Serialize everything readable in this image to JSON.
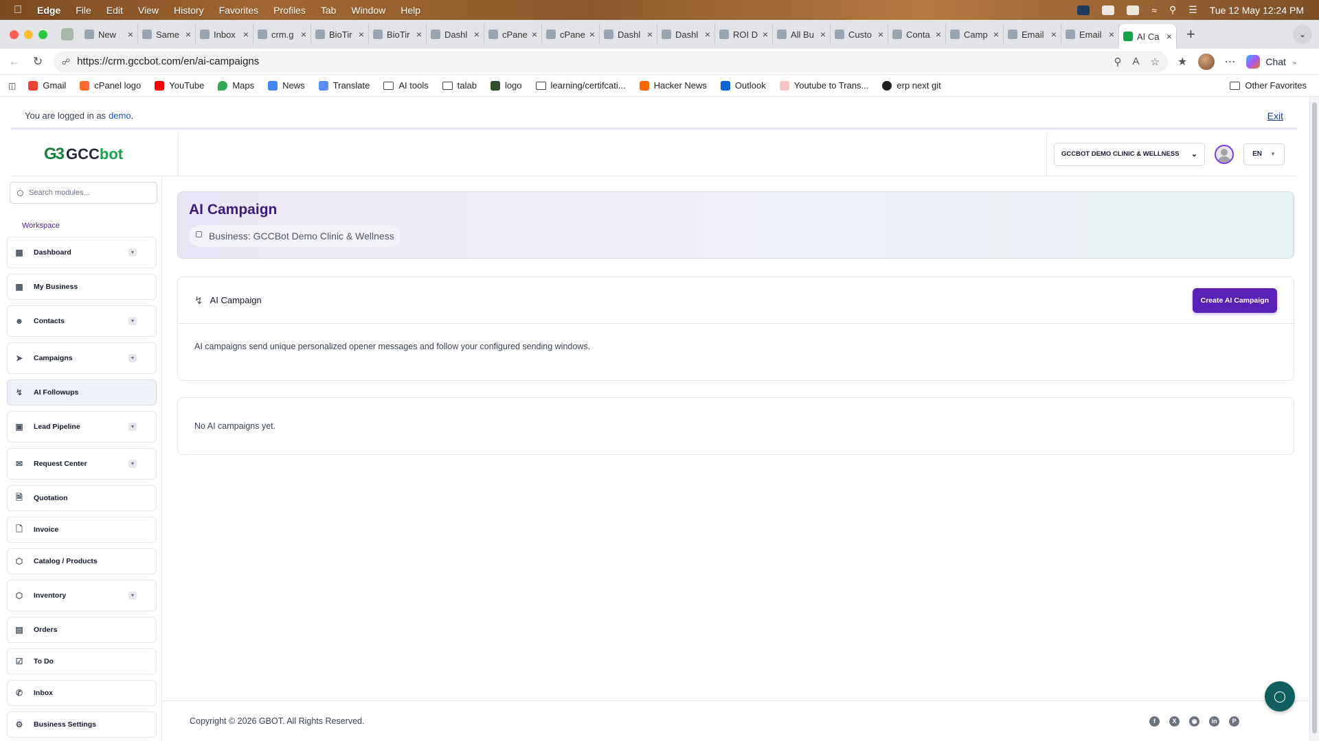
{
  "menubar": {
    "app": "Edge",
    "items": [
      "File",
      "Edit",
      "View",
      "History",
      "Favorites",
      "Profiles",
      "Tab",
      "Window",
      "Help"
    ],
    "clock": "Tue 12 May  12:24 PM"
  },
  "tabs": [
    {
      "title": "New"
    },
    {
      "title": "Same"
    },
    {
      "title": "Inbox"
    },
    {
      "title": "crm.g"
    },
    {
      "title": "BioTir"
    },
    {
      "title": "BioTir"
    },
    {
      "title": "Dashl"
    },
    {
      "title": "cPane"
    },
    {
      "title": "cPane"
    },
    {
      "title": "Dashl"
    },
    {
      "title": "Dashl"
    },
    {
      "title": "ROI D"
    },
    {
      "title": "All Bu"
    },
    {
      "title": "Custo"
    },
    {
      "title": "Conta"
    },
    {
      "title": "Camp"
    },
    {
      "title": "Email"
    },
    {
      "title": "Email"
    },
    {
      "title": "AI Ca"
    }
  ],
  "browser": {
    "url": "https://crm.gccbot.com/en/ai-campaigns",
    "chat_label": "Chat"
  },
  "bookmarks": {
    "items": [
      "Gmail",
      "cPanel logo",
      "YouTube",
      "Maps",
      "News",
      "Translate",
      "AI tools",
      "talab",
      "logo",
      "learning/certifcati...",
      "Hacker News",
      "Outlook",
      "Youtube to Trans...",
      "erp next git"
    ],
    "other": "Other Favorites"
  },
  "login": {
    "prefix": "You are logged in as",
    "user": "demo.",
    "exit": "Exit"
  },
  "header": {
    "logo_mark": "G3",
    "logo_gcc": "GCC",
    "logo_bot": "bot",
    "business_select": "GCCBOT DEMO CLINIC & WELLNESS",
    "language": "EN"
  },
  "sidebar": {
    "search_placeholder": "Search modules...",
    "section": "Workspace",
    "items": [
      {
        "label": "Dashboard",
        "icon": "grid-icon",
        "dropdown": true
      },
      {
        "label": "My Business",
        "icon": "building-icon",
        "dropdown": false
      },
      {
        "label": "Contacts",
        "icon": "users-icon",
        "dropdown": true
      },
      {
        "label": "Campaigns",
        "icon": "send-icon",
        "dropdown": true
      },
      {
        "label": "AI Followups",
        "icon": "bolt-icon",
        "dropdown": false,
        "active": true
      },
      {
        "label": "Lead Pipeline",
        "icon": "briefcase-icon",
        "dropdown": true
      },
      {
        "label": "Request Center",
        "icon": "inbox-icon",
        "dropdown": true
      },
      {
        "label": "Quotation",
        "icon": "file-dollar-icon",
        "dropdown": false
      },
      {
        "label": "Invoice",
        "icon": "file-text-icon",
        "dropdown": false
      },
      {
        "label": "Catalog / Products",
        "icon": "box-icon",
        "dropdown": false
      },
      {
        "label": "Inventory",
        "icon": "package-icon",
        "dropdown": true
      },
      {
        "label": "Orders",
        "icon": "bag-icon",
        "dropdown": false
      },
      {
        "label": "To Do",
        "icon": "checkbox-icon",
        "dropdown": false
      },
      {
        "label": "Inbox",
        "icon": "whatsapp-icon",
        "dropdown": false
      },
      {
        "label": "Business Settings",
        "icon": "gear-icon",
        "dropdown": false
      }
    ]
  },
  "main": {
    "title": "AI Campaign",
    "business_pill": "Business: GCCBot Demo Clinic & Wellness",
    "card_title": "AI Campaign",
    "create_button": "Create AI Campaign",
    "description": "AI campaigns send unique personalized opener messages and follow your configured sending windows.",
    "empty": "No AI campaigns yet."
  },
  "footer": {
    "copyright": "Copyright © 2026 GBOT. All Rights Reserved."
  },
  "colors": {
    "accent": "#5b21b6",
    "title": "#3b1a78",
    "brand_green": "#16a34a",
    "chat_fab": "#0f5f5c"
  }
}
